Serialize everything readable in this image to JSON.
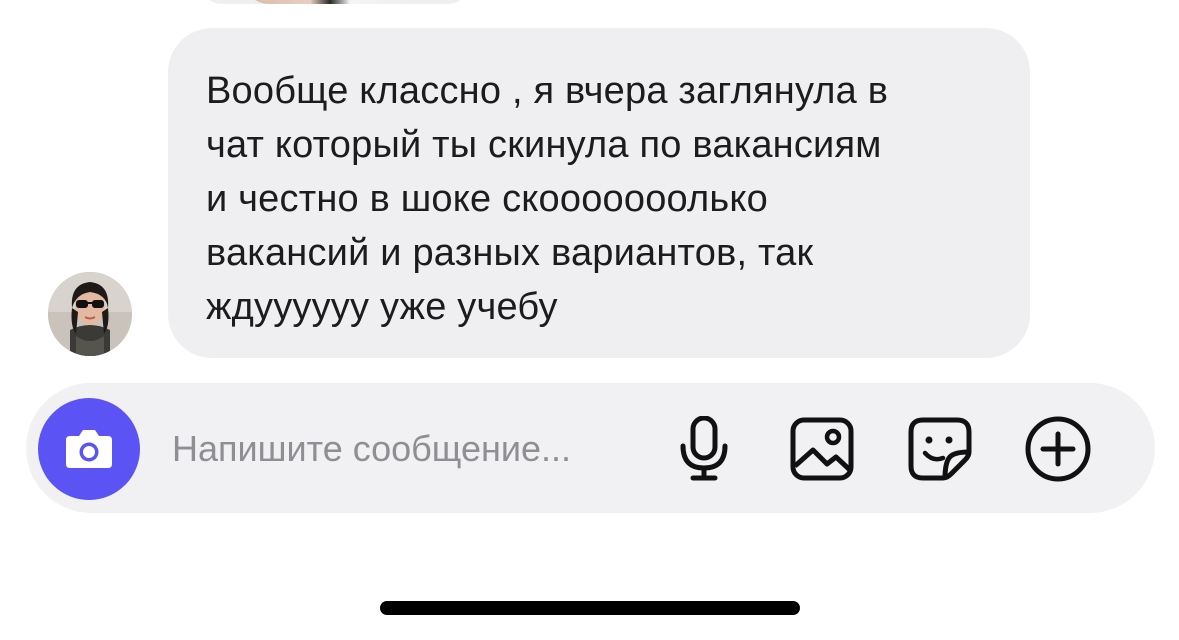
{
  "conversation": {
    "incoming_message": {
      "text": "Вообще классно , я вчера заглянула в\nчат который ты скинула по вакансиям\nи честно в шоке скооооооолько\nвакансий и разных вариантов, так\nждуууууу уже учебу"
    }
  },
  "composer": {
    "placeholder": "Напишите сообщение...",
    "value": "",
    "icons": {
      "camera": "camera-icon",
      "mic": "microphone-icon",
      "gallery": "image-gallery-icon",
      "sticker": "sticker-icon",
      "more": "plus-circle-icon"
    },
    "accent_color": "#5b53f4"
  },
  "colors": {
    "bubble_background": "#efeff2",
    "composer_background": "#f1f1f3",
    "text": "#1c1c1e",
    "placeholder": "#8e8e93"
  }
}
